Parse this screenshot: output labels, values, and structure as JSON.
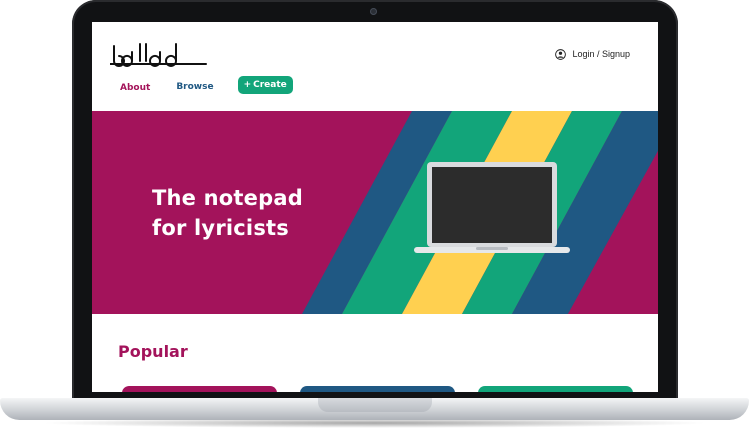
{
  "header": {
    "logo_icon": "ballad-logo",
    "login_label": "Login / Signup",
    "login_icon": "user-circle-icon"
  },
  "nav": {
    "about_label": "About",
    "browse_label": "Browse",
    "create_label": "Create",
    "create_icon": "plus-icon"
  },
  "hero": {
    "title_line1": "The notepad",
    "title_line2": "for lyricists",
    "image": "laptop-illustration"
  },
  "popular": {
    "title": "Popular"
  },
  "colors": {
    "brand_magenta": "#a3135b",
    "brand_blue": "#1f5883",
    "brand_green": "#12a57a",
    "brand_yellow": "#ffd050"
  }
}
